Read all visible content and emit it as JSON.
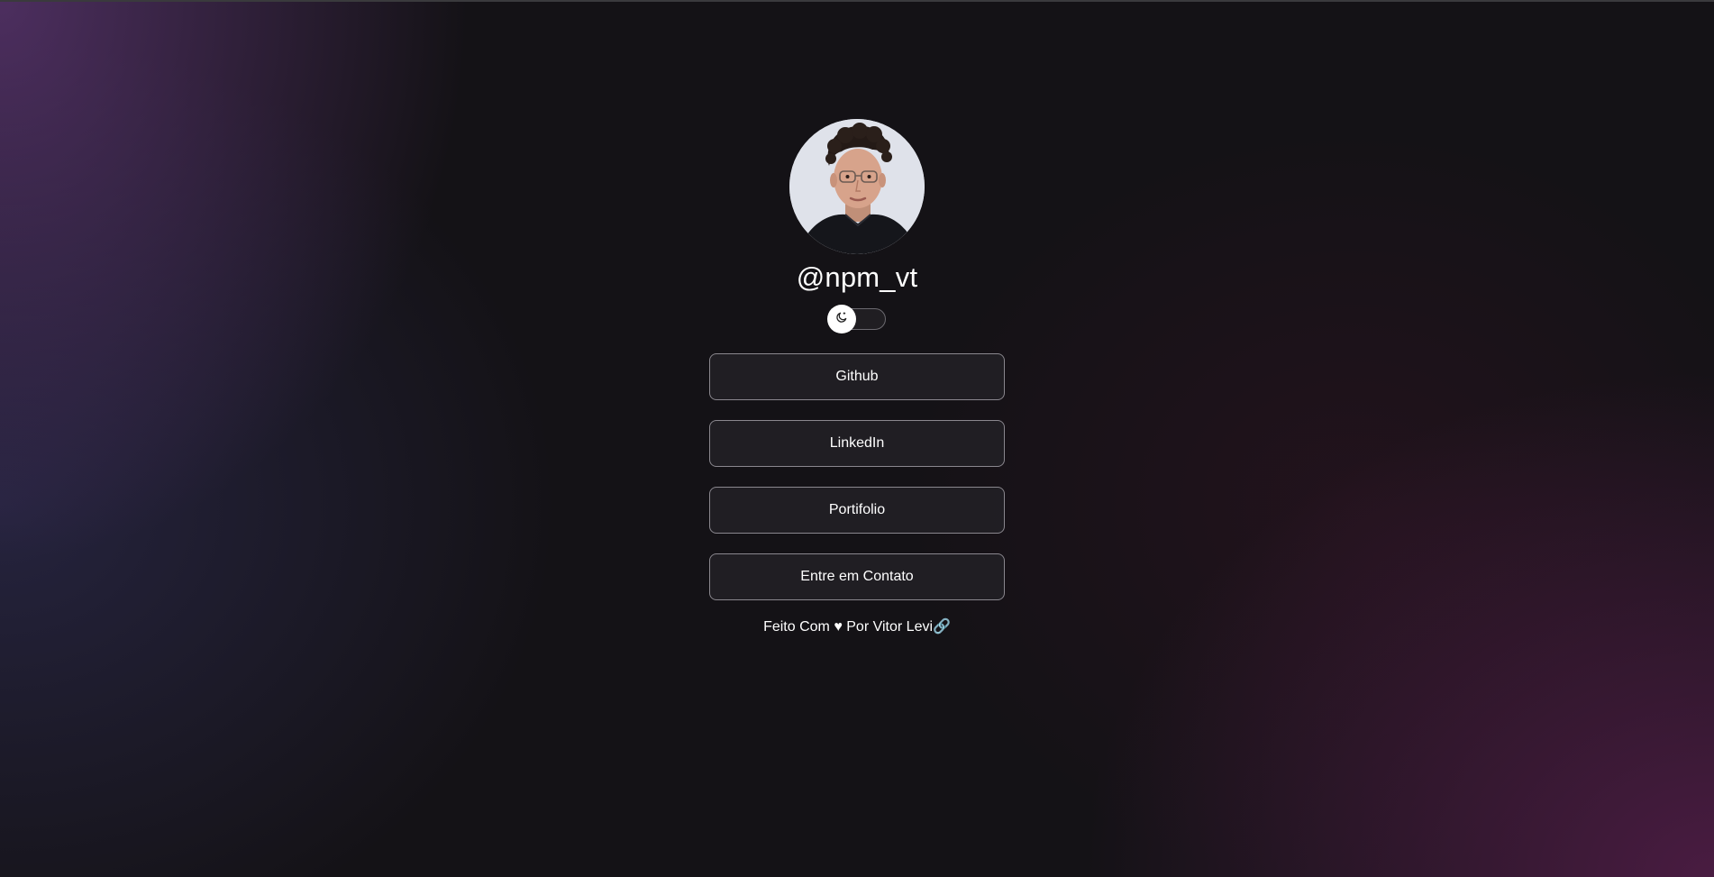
{
  "profile": {
    "handle": "@npm_vt",
    "avatar_alt": "avatar"
  },
  "theme_toggle": {
    "icon": "moon-icon",
    "state": "off"
  },
  "links": [
    {
      "label": "Github"
    },
    {
      "label": "LinkedIn"
    },
    {
      "label": "Portifolio"
    },
    {
      "label": "Entre em Contato"
    }
  ],
  "footer": {
    "prefix": "Feito Com ",
    "heart": "♥",
    "by": " Por ",
    "author": "Vitor Levi",
    "link_icon": "🔗"
  },
  "colors": {
    "background": "#141216",
    "accent_purple": "#603878",
    "accent_magenta": "#602054",
    "button_border": "#8a878e",
    "text": "#ffffff"
  }
}
